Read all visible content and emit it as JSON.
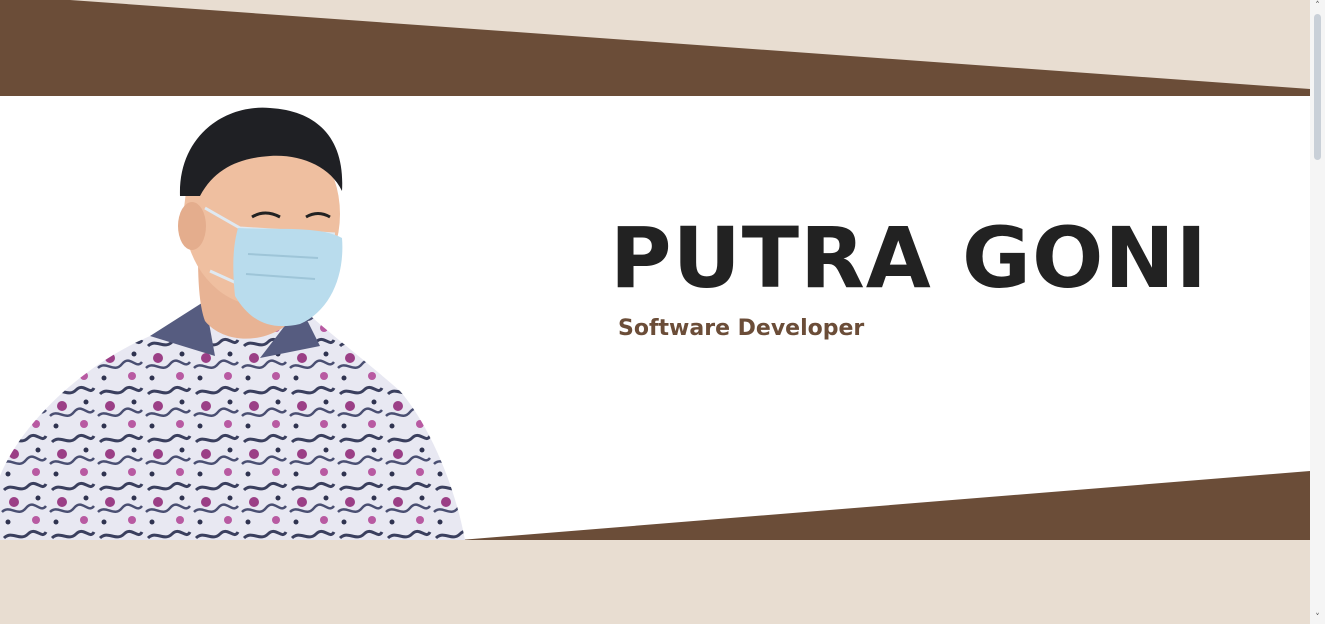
{
  "hero": {
    "name": "PUTRA GONI",
    "role": "Software Developer"
  },
  "colors": {
    "brown": "#6b4d38",
    "beige": "#e8ddd1",
    "white": "#ffffff",
    "text_dark": "#222222"
  },
  "icons": {
    "scroll_up": "chevron-up-icon",
    "scroll_down": "chevron-down-icon"
  },
  "scrollbar": {
    "up_glyph": "˄",
    "down_glyph": "˅"
  }
}
